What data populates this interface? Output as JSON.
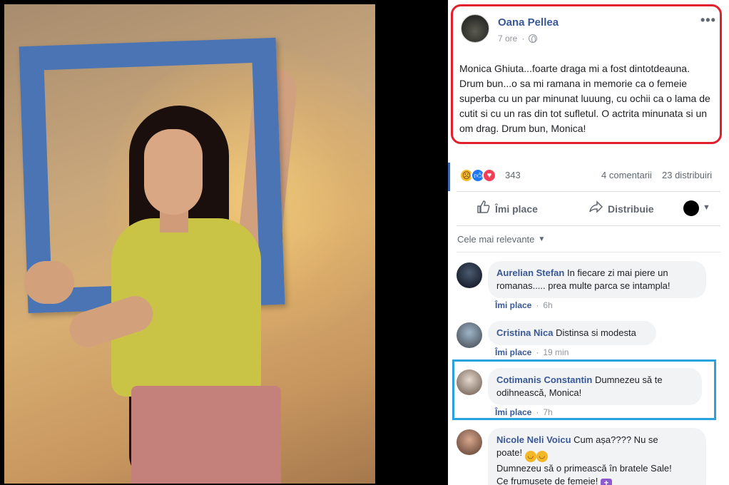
{
  "post": {
    "author": "Oana Pellea",
    "time": "7 ore",
    "more_icon": "•••",
    "text": "Monica Ghiuta...foarte draga mi a fost dintotdeauna. Drum bun...o sa mi ramana in memorie ca o femeie superba cu un par minunat luuung, cu ochii ca o lama de cutit si cu un ras din tot sufletul. O actrita minunata si un om drag. Drum bun, Monica!",
    "reactions_count": "343",
    "comments_count": "4 comentarii",
    "shares_count": "23 distribuiri",
    "reaction_icons": [
      "sad-reaction-icon",
      "like-reaction-icon",
      "love-reaction-icon"
    ]
  },
  "actions": {
    "like_label": "Îmi place",
    "share_label": "Distribuie"
  },
  "sort": {
    "label": "Cele mai relevante"
  },
  "comments": [
    {
      "name": "Aurelian Stefan",
      "text_line1": " In fiecare zi mai piere un",
      "text_line2": "romanas..... prea multe parca se intampla!",
      "like": "Îmi place",
      "time": "6h"
    },
    {
      "name": "Cristina Nica",
      "text_line1": " Distinsa si modesta",
      "like": "Îmi place",
      "time": "19 min"
    },
    {
      "name": "Cotimanis Constantin",
      "text_line1": " Dumnezeu să te",
      "text_line2": "odihnească, Monica!",
      "like": "Îmi place",
      "time": "7h"
    },
    {
      "name": "Nicole Neli Voicu",
      "text_line1": " Cum așa???? Nu se",
      "text_line2": "poate!",
      "text_line3": "Dumnezeu să o primească în bratele Sale!",
      "text_line4": "Ce frumusete de femeie!"
    }
  ],
  "colors": {
    "link_blue": "#385898",
    "red_highlight": "#e0202b",
    "blue_highlight": "#2aa2de"
  }
}
